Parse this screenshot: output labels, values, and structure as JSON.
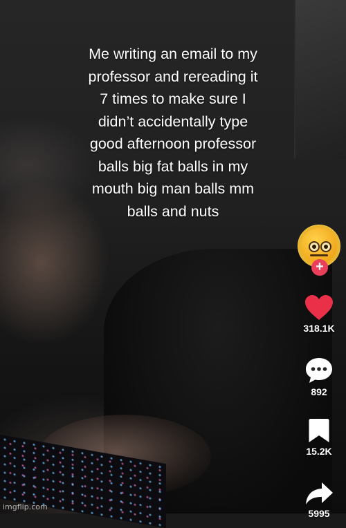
{
  "caption": {
    "lines": [
      "Me writing an email to my",
      "professor and rereading it",
      "7 times to make sure I",
      "didn’t accidentally type",
      "good afternoon professor",
      "balls big fat balls in my",
      "mouth big man balls mm",
      "balls and nuts"
    ]
  },
  "rail": {
    "avatar_icon": "neutral-face-emoji",
    "follow_symbol": "+",
    "like": {
      "icon": "heart-icon",
      "count": "318.1K",
      "color": "#ea2f49"
    },
    "comment": {
      "icon": "comment-bubble-icon",
      "count": "892"
    },
    "save": {
      "icon": "bookmark-icon",
      "count": "15.2K"
    },
    "share": {
      "icon": "share-arrow-icon",
      "count": "5995"
    }
  },
  "watermark": "imgflip.com"
}
